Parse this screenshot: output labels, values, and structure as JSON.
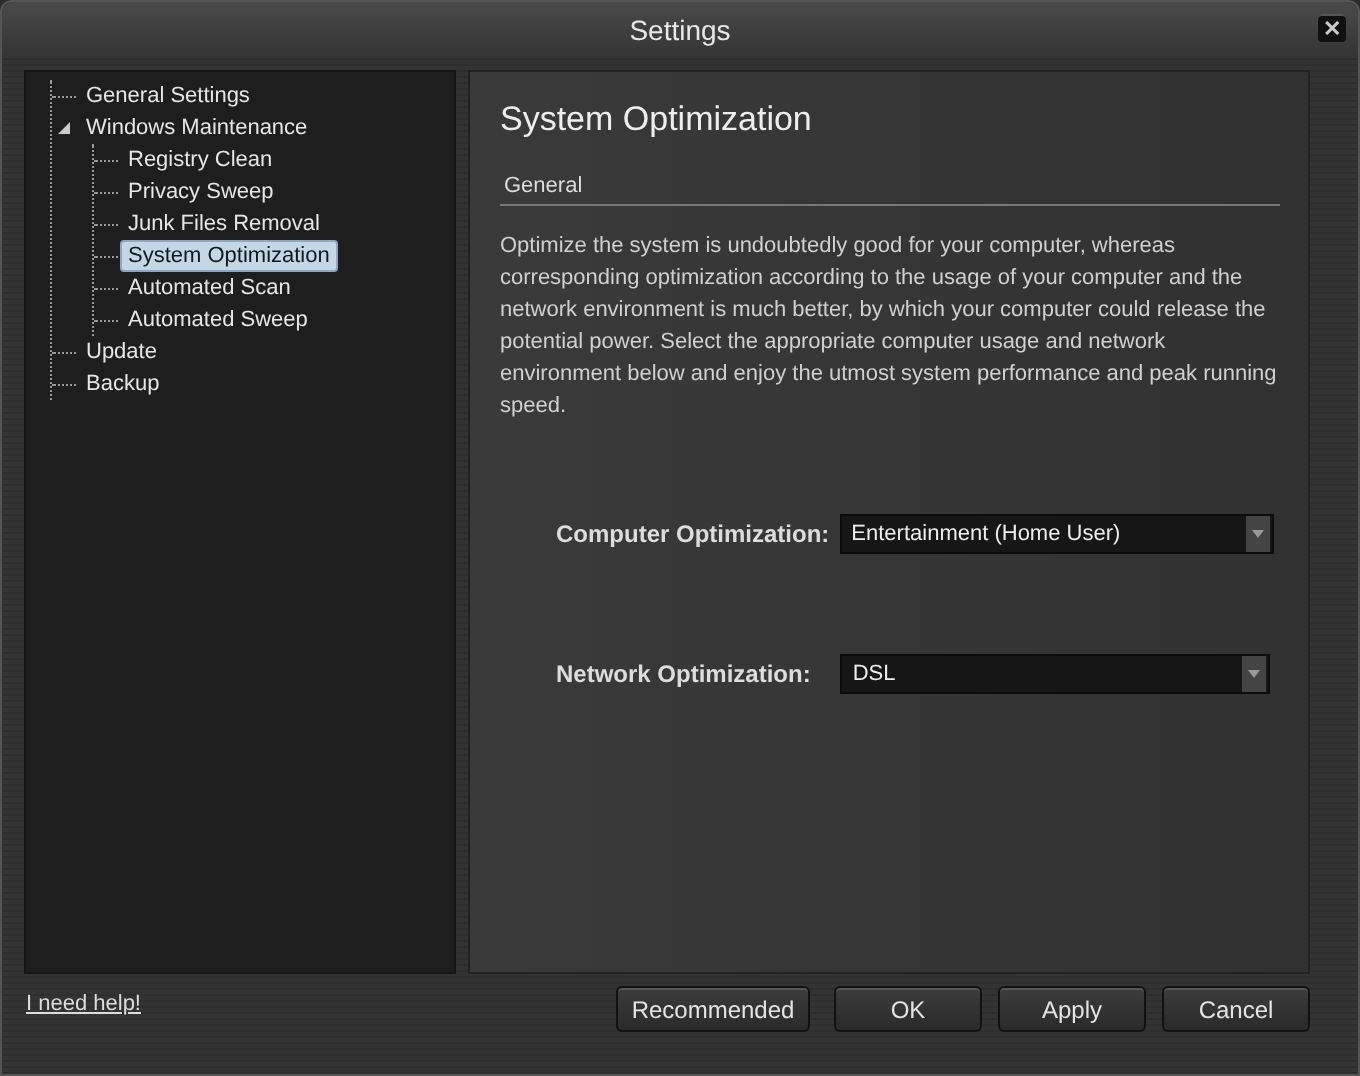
{
  "window": {
    "title": "Settings",
    "close_icon": "✕"
  },
  "tree": [
    {
      "label": "General Settings",
      "selected": false
    },
    {
      "label": "Windows Maintenance",
      "selected": false,
      "expanded": true,
      "children": [
        {
          "label": "Registry Clean",
          "selected": false
        },
        {
          "label": "Privacy Sweep",
          "selected": false
        },
        {
          "label": "Junk Files Removal",
          "selected": false
        },
        {
          "label": "System Optimization",
          "selected": true
        },
        {
          "label": "Automated Scan",
          "selected": false
        },
        {
          "label": "Automated Sweep",
          "selected": false
        }
      ]
    },
    {
      "label": "Update",
      "selected": false
    },
    {
      "label": "Backup",
      "selected": false
    }
  ],
  "content": {
    "heading": "System Optimization",
    "section": "General",
    "description": "Optimize the system is undoubtedly good for your computer, whereas corresponding optimization according to the usage of your computer and the network environment is much better, by which your computer could release the potential power. Select the appropriate computer usage and network environment below and enjoy the utmost system performance and peak running speed.",
    "fields": [
      {
        "label": "Computer Optimization:",
        "value": "Entertainment (Home User)"
      },
      {
        "label": "Network Optimization:",
        "value": "DSL"
      }
    ]
  },
  "help_link": "I need help!",
  "buttons": [
    "Recommended",
    "OK",
    "Apply",
    "Cancel"
  ]
}
